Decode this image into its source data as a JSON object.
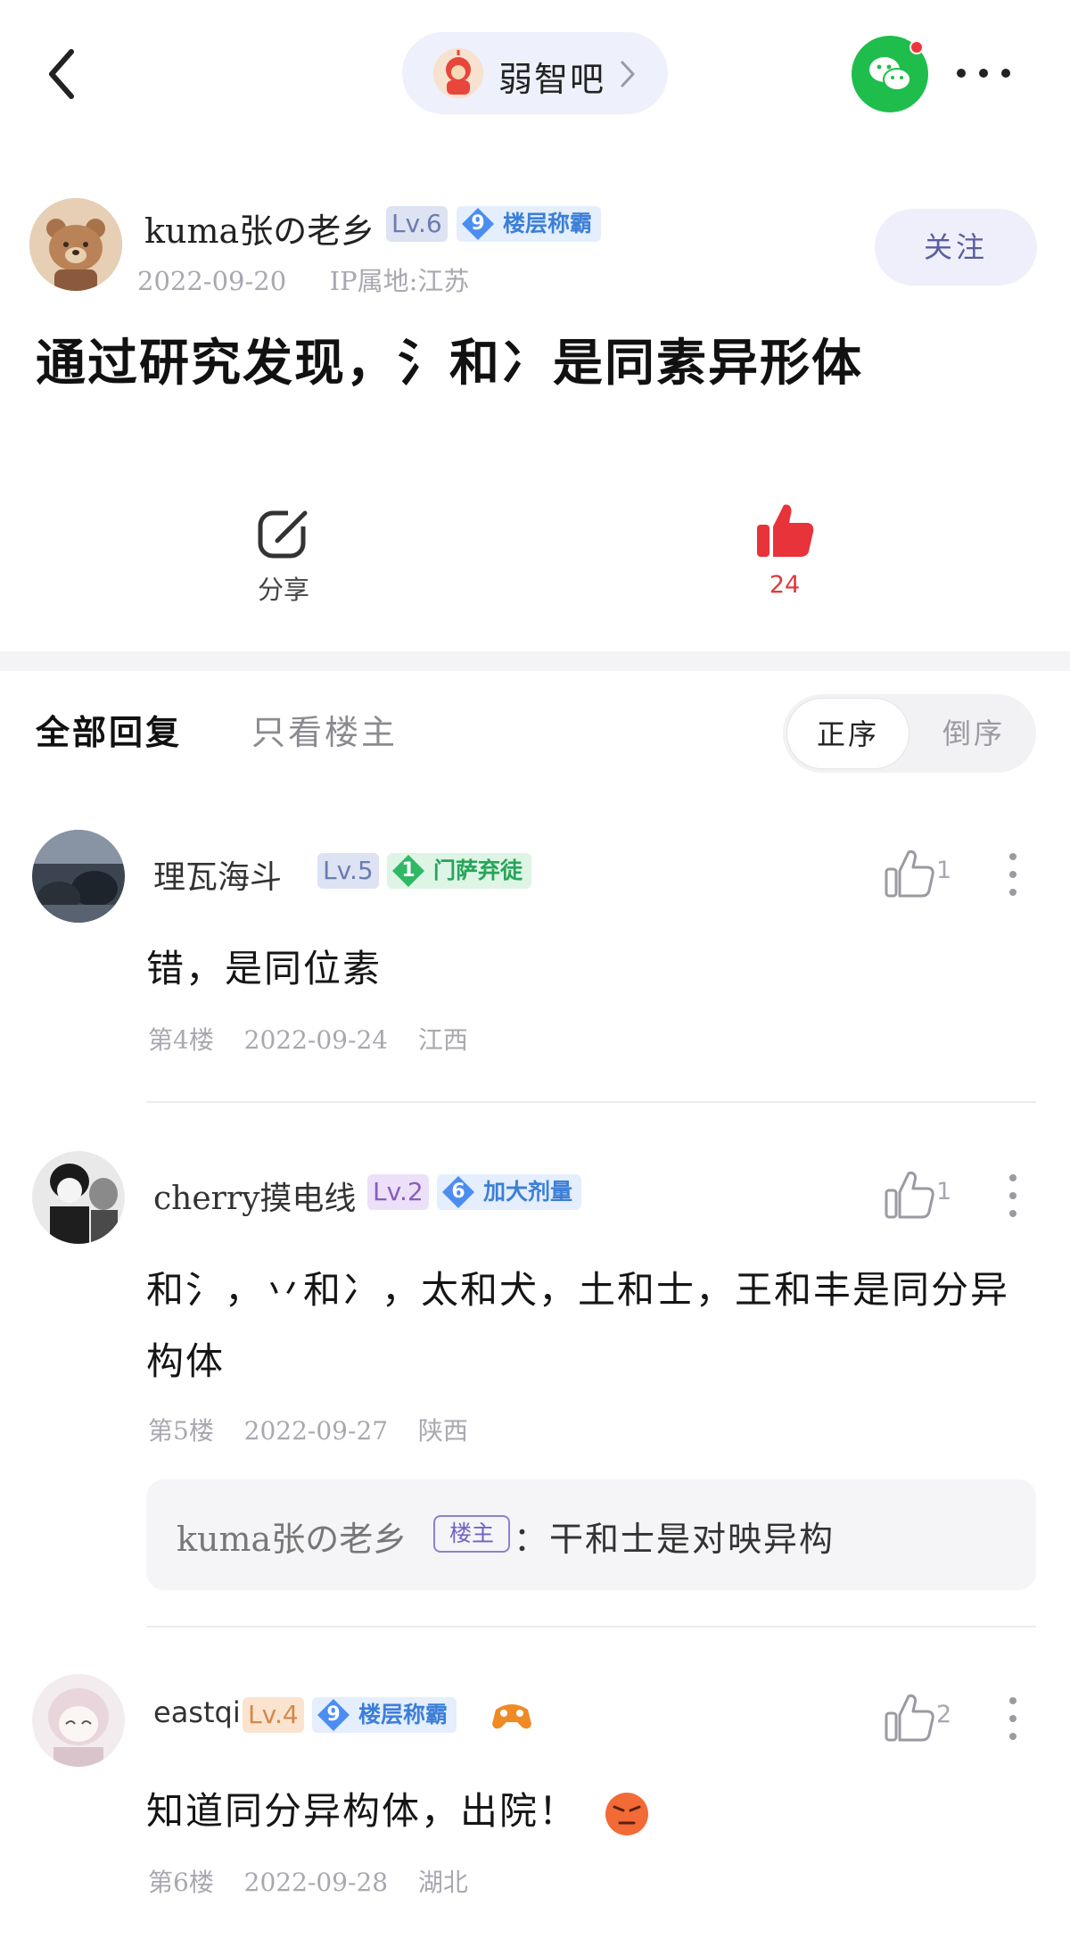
{
  "header": {
    "forum_name": "弱智吧",
    "icons": {
      "back": "chevron-left-icon",
      "forum_arrow": "chevron-right-icon",
      "share": "wechat-icon",
      "more": "ellipsis-icon"
    },
    "accent": "#1fbe4c"
  },
  "post": {
    "author": "kuma张の老乡",
    "level": "Lv.6",
    "badge_num": "9",
    "badge_title": "楼层称霸",
    "date": "2022-09-20",
    "ip_location": "IP属地:江苏",
    "follow_label": "关注",
    "title": "通过研究发现，氵和冫是同素异形体",
    "share_label": "分享",
    "like_count": "24",
    "like_color": "#e8333b"
  },
  "tabs": {
    "all_replies": "全部回复",
    "op_only": "只看楼主",
    "sort_asc": "正序",
    "sort_desc": "倒序"
  },
  "replies": [
    {
      "author": "理瓦海斗",
      "level": "Lv.5",
      "badge_num": "1",
      "badge_title": "门萨弃徒",
      "likes": "1",
      "text": "错，是同位素",
      "floor": "第4楼",
      "date": "2022-09-24",
      "location": "江西"
    },
    {
      "author": "cherry摸电线",
      "level": "Lv.2",
      "badge_num": "6",
      "badge_title": "加大剂量",
      "likes": "1",
      "text": "和氵，丷和冫，太和犬，土和士，王和丰是同分异构体",
      "floor": "第5楼",
      "date": "2022-09-27",
      "location": "陕西",
      "subreply": {
        "author": "kuma张の老乡",
        "tag": "楼主",
        "text": "：干和士是对映异构"
      }
    },
    {
      "author": "eastqi",
      "level": "Lv.4",
      "badge_num": "9",
      "badge_title": "楼层称霸",
      "likes": "2",
      "text": "知道同分异构体，出院！",
      "floor": "第6楼",
      "date": "2022-09-28",
      "location": "湖北"
    }
  ]
}
